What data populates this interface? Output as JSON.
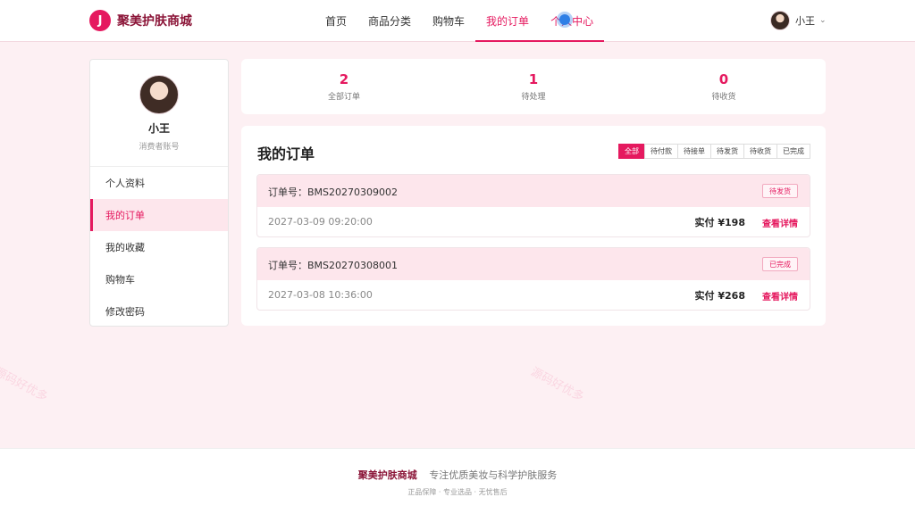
{
  "header": {
    "brand_logo": "J",
    "brand_name": "聚美护肤商城",
    "nav": [
      {
        "label": "首页"
      },
      {
        "label": "商品分类"
      },
      {
        "label": "购物车"
      },
      {
        "label": "我的订单"
      },
      {
        "label": "个人中心"
      }
    ],
    "active_nav": "我的订单",
    "user_name": "小王",
    "user_menu_icon": "chevron-down-icon"
  },
  "sidebar": {
    "name": "小王",
    "role": "消费者账号",
    "items": [
      {
        "label": "个人资料"
      },
      {
        "label": "我的订单"
      },
      {
        "label": "我的收藏"
      },
      {
        "label": "购物车"
      },
      {
        "label": "修改密码"
      }
    ],
    "active_item": "我的订单"
  },
  "stats": [
    {
      "value": "2",
      "label": "全部订单"
    },
    {
      "value": "1",
      "label": "待处理"
    },
    {
      "value": "0",
      "label": "待收货"
    }
  ],
  "orders": {
    "title": "我的订单",
    "filters": [
      "全部",
      "待付款",
      "待接单",
      "待发货",
      "待收货",
      "已完成"
    ],
    "active_filter": "全部",
    "list": [
      {
        "order_no": "订单号：BMS20270309002",
        "status": "待发货",
        "time": "2027-03-09 09:20:00",
        "pay": "实付 ¥198",
        "detail": "查看详情"
      },
      {
        "order_no": "订单号：BMS20270308001",
        "status": "已完成",
        "time": "2027-03-08 10:36:00",
        "pay": "实付 ¥268",
        "detail": "查看详情"
      }
    ]
  },
  "footer": {
    "brand": "聚美护肤商城",
    "slogan": "专注优质美妆与科学护肤服务",
    "tagline": "正品保障 · 专业选品 · 无忧售后"
  },
  "watermark": "源码好优多",
  "colors": {
    "accent": "#e5195f",
    "brand_dark": "#8b1538",
    "bg": "#fdf0f3",
    "cursor": "#2f7fe6"
  }
}
